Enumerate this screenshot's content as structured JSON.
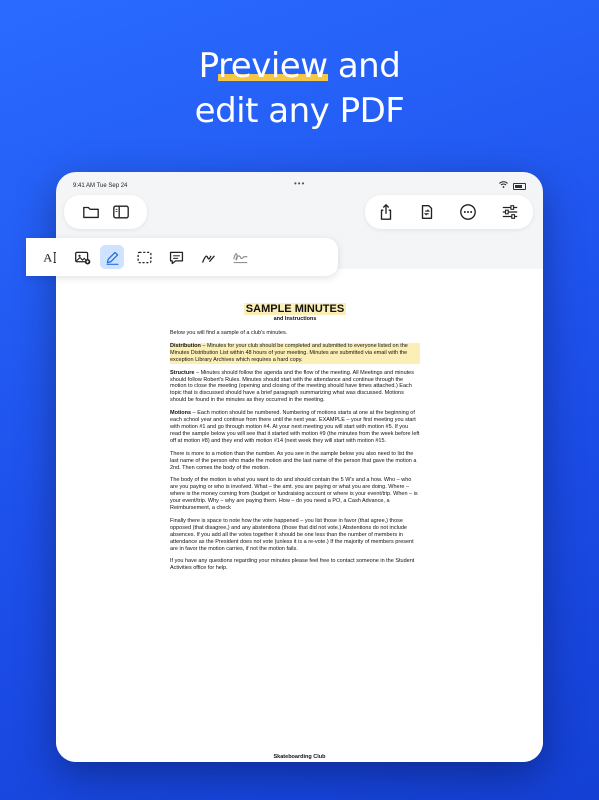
{
  "headline": {
    "line1_pre": "P",
    "line1_highlight": "review",
    "line1_post": " and",
    "line2": "edit any PDF"
  },
  "status_bar": {
    "time": "9:41 AM  Tue Sep 24",
    "dots": "•••"
  },
  "toolbar": {
    "left": [
      {
        "icon": "folder-icon",
        "name": "folder-button"
      },
      {
        "icon": "sidebar-icon",
        "name": "sidebar-toggle-button"
      }
    ],
    "right": [
      {
        "icon": "share-icon",
        "name": "share-button"
      },
      {
        "icon": "page-convert-icon",
        "name": "convert-button"
      },
      {
        "icon": "more-icon",
        "name": "more-button"
      },
      {
        "icon": "settings-sliders-icon",
        "name": "settings-button"
      }
    ]
  },
  "annotation_tools": {
    "active": "highlight",
    "tools": [
      "text",
      "image",
      "highlight",
      "selection",
      "comment",
      "draw",
      "signature"
    ],
    "text_label": "A"
  },
  "document": {
    "title": "SAMPLE MINUTES",
    "subtitle": "and Instructions",
    "paragraphs": [
      {
        "lead": "",
        "text": "Below you will find a sample of a club's minutes.",
        "highlight": false
      },
      {
        "lead": "Distribution",
        "text": " – Minutes for your club should be completed and submitted to everyone listed on the Minutes Distribution List within 48 hours of your meeting. Minutes are submitted via email with the exception Library Archives which requires a hard copy.",
        "highlight": true
      },
      {
        "lead": "Structure",
        "text": " – Minutes should follow the agenda and the flow of the meeting.  All Meetings and minutes should follow Robert's Rules. Minutes should start with the attendance and continue through the motion to close the meeting (opening and closing of the meeting should have times attached.) Each topic that is discussed should have a brief paragraph summarizing what was discussed. Motions should be found in the minutes as they occurred in the meeting.",
        "highlight": false
      },
      {
        "lead": "Motions",
        "text": " – Each motion should be numbered. Numbering of motions starts at one at the beginning of each school year and continue from there until the next year.  EXAMPLE – your first meeting you start with motion #1 and go through motion #4.  At your next meeting you will start with motion #5.  If you read the sample below you will see that it started with motion #9 (the minutes from the week before left off at motion #8) and they end with motion #14 (next week they will start with motion #15.",
        "highlight": false
      },
      {
        "lead": "",
        "text": "There is more to a motion than the number.  As you see in the sample below you also need to list the last name of the person who made the motion and the last name of the person that gave the motion a 2nd.  Then comes the body of the motion.",
        "highlight": false
      },
      {
        "lead": "",
        "text": "The body of the motion is what you want to do and should contain the 5 W's and a how.  Who – who are you paying or who is involved. What – the amt. you are paying or what you are doing. Where – where is the money coming from (budget or fundraising account or where is your event/trip. When – is your event/trip. Why – why are paying them. How – do you need a PO, a Cash Advance, a Reimbursement, a check",
        "highlight": false
      },
      {
        "lead": "",
        "text": "Finally there is space to note how the vote happened – you list those in favor (that agree,) those opposed (that disagree,) and any abstentions (those that did not vote.) Abstentions do not include absences.  If you add all the votes together it should be one less than the number of members in attendance as the President does not vote (unless it is a re-vote.)  If the majority of members present are in favor the motion carries, if not the motion fails.",
        "highlight": false
      },
      {
        "lead": "",
        "text": "If you have any questions regarding your minutes please feel free to contact someone in the Student Activities office for help.",
        "highlight": false
      }
    ],
    "next_page_title": "Skateboarding Club"
  },
  "colors": {
    "background": "#2163f6",
    "highlight": "#fbeeb6",
    "accent_underline": "#f6c744",
    "active_tool": "#cfe3ff",
    "active_icon": "#1f6fe5"
  }
}
